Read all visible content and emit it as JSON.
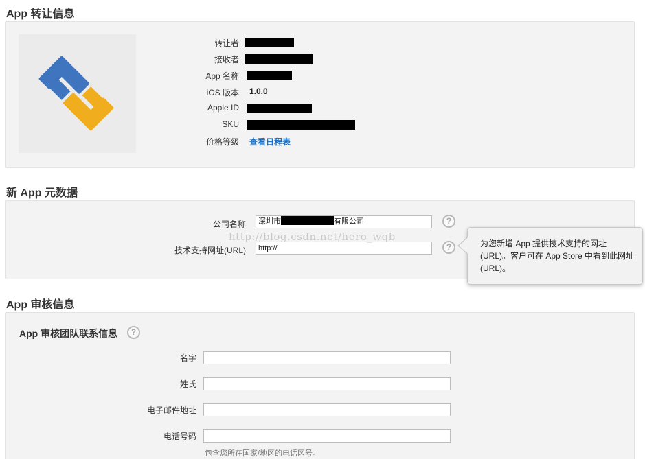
{
  "transfer": {
    "section_title": "App 转让信息",
    "rows": [
      {
        "label": "转让者",
        "value": "",
        "redacted": true
      },
      {
        "label": "接收者",
        "value": "",
        "redacted": true
      },
      {
        "label": "App 名称",
        "value": "",
        "redacted": true
      },
      {
        "label": "iOS 版本",
        "value": "1.0.0",
        "redacted": false
      },
      {
        "label": "Apple ID",
        "value": "",
        "redacted": true
      },
      {
        "label": "SKU",
        "value": "",
        "redacted": true
      },
      {
        "label": "价格等级",
        "value": "查看日程表",
        "redacted": false
      }
    ],
    "logo_colors": {
      "blue": "#3f74bf",
      "yellow": "#f0ad1e"
    }
  },
  "metadata": {
    "section_title": "新 App 元数据",
    "company_label": "公司名称",
    "company_value_prefix": "深圳市",
    "company_value_suffix": "有限公司",
    "support_url_label": "技术支持网址(URL)",
    "support_url_value": "http://",
    "help_symbol": "?",
    "watermark": "http://blog.csdn.net/hero_wqb",
    "tooltip": "为您新增 App 提供技术支持的网址 (URL)。客户可在 App Store 中看到此网址(URL)。"
  },
  "review": {
    "section_title": "App 审核信息",
    "subsection_title": "App 审核团队联系信息",
    "help_symbol": "?",
    "first_name_label": "名字",
    "first_name_value": "",
    "last_name_label": "姓氏",
    "last_name_value": "",
    "email_label": "电子邮件地址",
    "email_value": "",
    "phone_label": "电话号码",
    "phone_value": "",
    "phone_hint": "包含您所在国家/地区的电话区号。"
  }
}
